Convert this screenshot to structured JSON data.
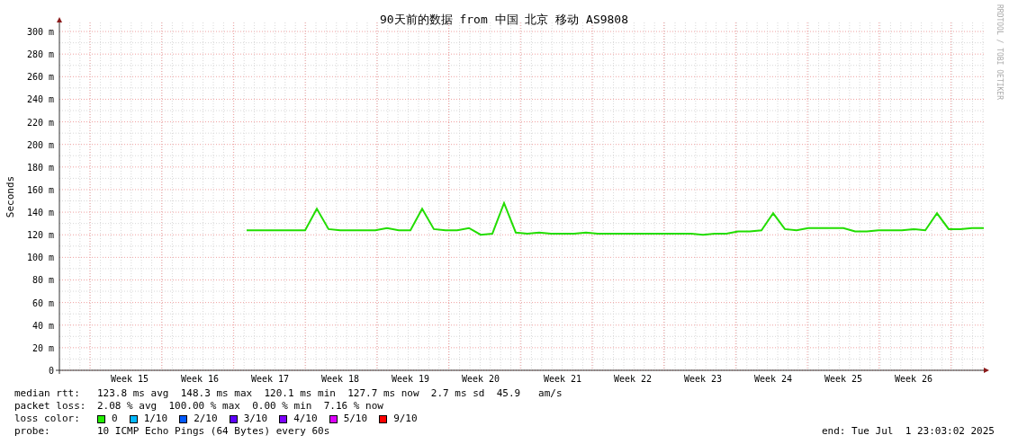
{
  "chart": {
    "chart_data": {
      "type": "line",
      "title": "90天前的数据 from 中国 北京 移动 AS9808",
      "ylabel": "Seconds",
      "ylim": [
        0,
        308
      ],
      "grid": true,
      "yticks": [
        {
          "value": 0,
          "label": "0"
        },
        {
          "value": 20,
          "label": "20 m"
        },
        {
          "value": 40,
          "label": "40 m"
        },
        {
          "value": 60,
          "label": "60 m"
        },
        {
          "value": 80,
          "label": "80 m"
        },
        {
          "value": 100,
          "label": "100 m"
        },
        {
          "value": 120,
          "label": "120 m"
        },
        {
          "value": 140,
          "label": "140 m"
        },
        {
          "value": 160,
          "label": "160 m"
        },
        {
          "value": 180,
          "label": "180 m"
        },
        {
          "value": 200,
          "label": "200 m"
        },
        {
          "value": 220,
          "label": "220 m"
        },
        {
          "value": 240,
          "label": "240 m"
        },
        {
          "value": 260,
          "label": "260 m"
        },
        {
          "value": 280,
          "label": "280 m"
        },
        {
          "value": 300,
          "label": "300 m"
        }
      ],
      "categories": [
        null,
        null,
        null,
        null,
        null,
        null,
        "Week 15",
        null,
        null,
        null,
        null,
        null,
        "Week 16",
        null,
        null,
        null,
        null,
        null,
        "Week 17",
        null,
        null,
        null,
        null,
        null,
        "Week 18",
        null,
        null,
        null,
        null,
        null,
        "Week 19",
        null,
        null,
        null,
        null,
        null,
        "Week 20",
        null,
        null,
        null,
        null,
        null,
        null,
        "Week 21",
        null,
        null,
        null,
        null,
        null,
        "Week 22",
        null,
        null,
        null,
        null,
        null,
        "Week 23",
        null,
        null,
        null,
        null,
        null,
        "Week 24",
        null,
        null,
        null,
        null,
        null,
        "Week 25",
        null,
        null,
        null,
        null,
        null,
        "Week 26",
        null,
        null,
        null,
        null,
        null,
        null
      ],
      "series": [
        {
          "color": "#22dd00",
          "values": [
            null,
            null,
            null,
            null,
            null,
            null,
            null,
            null,
            null,
            null,
            null,
            null,
            null,
            null,
            null,
            null,
            124,
            124,
            124,
            124,
            124,
            124,
            143,
            125,
            124,
            124,
            124,
            124,
            126,
            124,
            124,
            143,
            125,
            124,
            124,
            126,
            120,
            121,
            148,
            122,
            121,
            122,
            121,
            121,
            121,
            122,
            121,
            121,
            121,
            121,
            121,
            121,
            121,
            121,
            121,
            120,
            121,
            121,
            123,
            123,
            124,
            139,
            125,
            124,
            126,
            126,
            126,
            126,
            123,
            123,
            124,
            124,
            124,
            125,
            124,
            139,
            125,
            125,
            126,
            126
          ]
        }
      ]
    }
  },
  "watermark": "RRDTOOL / TOBI OETIKER",
  "stats": [
    {
      "label": "median rtt:",
      "text": "123.8 ms avg  148.3 ms max  120.1 ms min  127.7 ms now  2.7 ms sd  45.9   am/s"
    },
    {
      "label": "packet loss:",
      "text": "2.08 % avg  100.00 % max  0.00 % min  7.16 % now"
    }
  ],
  "loss_color": {
    "label": "loss color:",
    "items": [
      {
        "label": "0",
        "color": "#22ee00"
      },
      {
        "label": "1/10",
        "color": "#00b8ff"
      },
      {
        "label": "2/10",
        "color": "#0059ff"
      },
      {
        "label": "3/10",
        "color": "#5e00ff"
      },
      {
        "label": "4/10",
        "color": "#7e00ff"
      },
      {
        "label": "5/10",
        "color": "#dd00ff"
      },
      {
        "label": "9/10",
        "color": "#ff0000"
      }
    ]
  },
  "probe": {
    "label": "probe:",
    "text": "10 ICMP Echo Pings (64 Bytes) every 60s"
  },
  "end": "end: Tue Jul  1 23:03:02 2025"
}
